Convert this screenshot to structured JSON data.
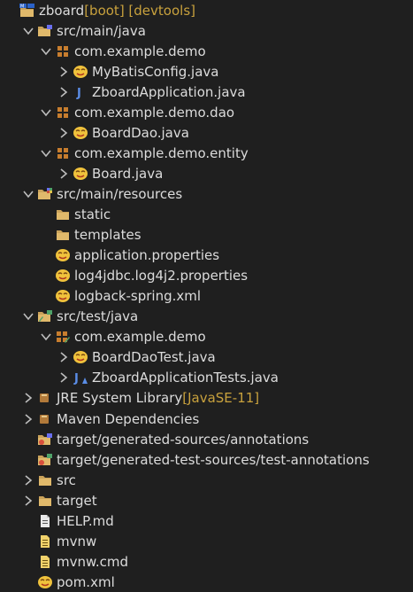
{
  "tree": [
    {
      "label": "zboard",
      "decoration": " [boot] [devtools]",
      "icon": "project-icon",
      "chevron": "none",
      "depth": 0
    },
    {
      "label": "src/main/java",
      "decoration": "",
      "icon": "source-folder-icon",
      "chevron": "expanded",
      "depth": 1
    },
    {
      "label": "com.example.demo",
      "decoration": "",
      "icon": "package-icon",
      "chevron": "expanded",
      "depth": 2
    },
    {
      "label": "MyBatisConfig.java",
      "decoration": "",
      "icon": "contributor-icon",
      "chevron": "collapsed",
      "depth": 3
    },
    {
      "label": "ZboardApplication.java",
      "decoration": "",
      "icon": "java-file-icon",
      "chevron": "collapsed",
      "depth": 3
    },
    {
      "label": "com.example.demo.dao",
      "decoration": "",
      "icon": "package-icon",
      "chevron": "expanded",
      "depth": 2
    },
    {
      "label": "BoardDao.java",
      "decoration": "",
      "icon": "contributor-icon",
      "chevron": "collapsed",
      "depth": 3
    },
    {
      "label": "com.example.demo.entity",
      "decoration": "",
      "icon": "package-icon",
      "chevron": "expanded",
      "depth": 2
    },
    {
      "label": "Board.java",
      "decoration": "",
      "icon": "contributor-icon",
      "chevron": "collapsed",
      "depth": 3
    },
    {
      "label": "src/main/resources",
      "decoration": "",
      "icon": "resource-folder-icon",
      "chevron": "expanded",
      "depth": 1
    },
    {
      "label": "static",
      "decoration": "",
      "icon": "folder-icon",
      "chevron": "none",
      "depth": 2
    },
    {
      "label": "templates",
      "decoration": "",
      "icon": "folder-icon",
      "chevron": "none",
      "depth": 2
    },
    {
      "label": "application.properties",
      "decoration": "",
      "icon": "contributor-icon",
      "chevron": "none",
      "depth": 2
    },
    {
      "label": "log4jdbc.log4j2.properties",
      "decoration": "",
      "icon": "contributor-icon",
      "chevron": "none",
      "depth": 2
    },
    {
      "label": "logback-spring.xml",
      "decoration": "",
      "icon": "contributor-icon",
      "chevron": "none",
      "depth": 2
    },
    {
      "label": "src/test/java",
      "decoration": "",
      "icon": "test-folder-icon",
      "chevron": "expanded",
      "depth": 1
    },
    {
      "label": "com.example.demo",
      "decoration": "",
      "icon": "test-package-icon",
      "chevron": "expanded",
      "depth": 2
    },
    {
      "label": "BoardDaoTest.java",
      "decoration": "",
      "icon": "contributor-icon",
      "chevron": "collapsed",
      "depth": 3
    },
    {
      "label": "ZboardApplicationTests.java",
      "decoration": "",
      "icon": "test-java-file-icon",
      "chevron": "collapsed",
      "depth": 3
    },
    {
      "label": "JRE System Library",
      "decoration": " [JavaSE-11]",
      "icon": "library-icon",
      "chevron": "collapsed",
      "depth": 1
    },
    {
      "label": "Maven Dependencies",
      "decoration": "",
      "icon": "library-icon",
      "chevron": "collapsed",
      "depth": 1
    },
    {
      "label": "target/generated-sources/annotations",
      "decoration": "",
      "icon": "generated-folder-icon",
      "chevron": "none",
      "depth": 1
    },
    {
      "label": "target/generated-test-sources/test-annotations",
      "decoration": "",
      "icon": "generated-test-folder-icon",
      "chevron": "none",
      "depth": 1
    },
    {
      "label": "src",
      "decoration": "",
      "icon": "folder-icon",
      "chevron": "collapsed",
      "depth": 1
    },
    {
      "label": "target",
      "decoration": "",
      "icon": "folder-icon",
      "chevron": "collapsed",
      "depth": 1
    },
    {
      "label": "HELP.md",
      "decoration": "",
      "icon": "file-icon",
      "chevron": "none",
      "depth": 1
    },
    {
      "label": "mvnw",
      "decoration": "",
      "icon": "text-file-icon",
      "chevron": "none",
      "depth": 1
    },
    {
      "label": "mvnw.cmd",
      "decoration": "",
      "icon": "text-file-icon",
      "chevron": "none",
      "depth": 1
    },
    {
      "label": "pom.xml",
      "decoration": "",
      "icon": "contributor-icon",
      "chevron": "none",
      "depth": 1
    }
  ],
  "colors": {
    "background": "#1f1f1f",
    "text": "#dcdcdc",
    "decoration": "#c8a13d",
    "folder": "#c9a25a",
    "package": "#c77d2e",
    "java": "#5a8de6",
    "contributor": "#f0c23c"
  }
}
